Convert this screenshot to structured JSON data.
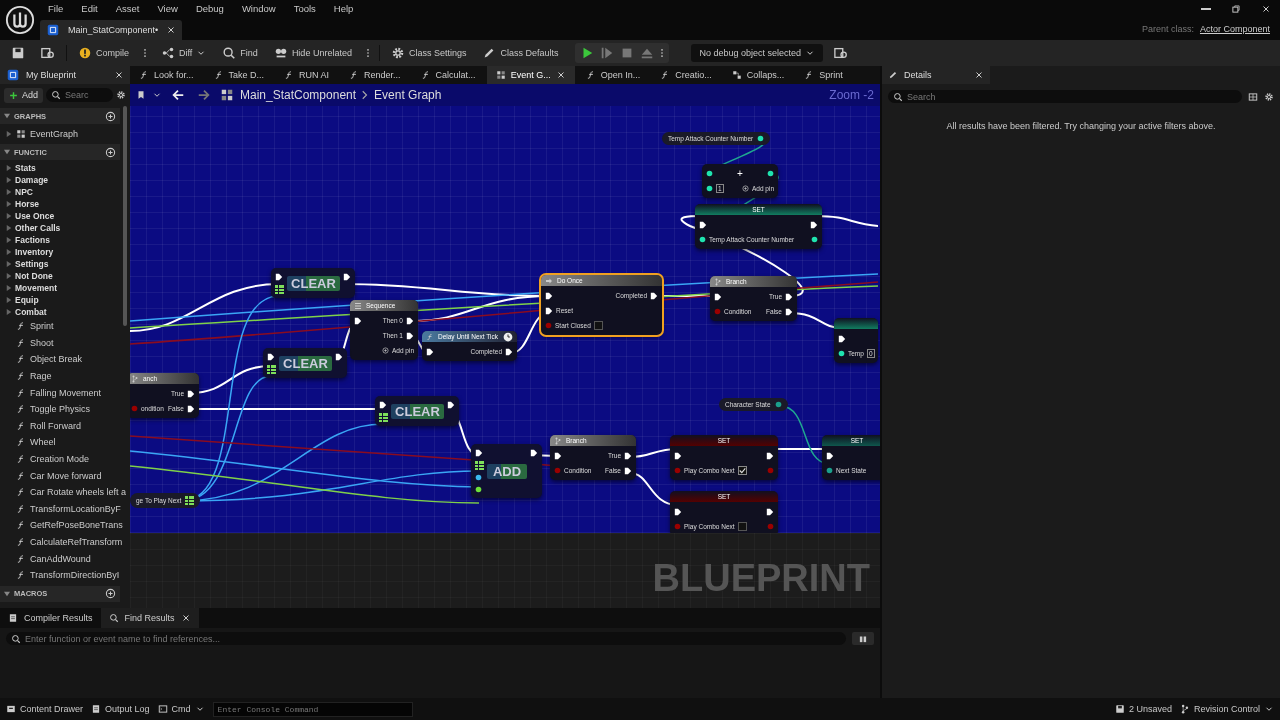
{
  "menu": [
    "File",
    "Edit",
    "Asset",
    "View",
    "Debug",
    "Window",
    "Tools",
    "Help"
  ],
  "document_tab": {
    "label": "Main_StatComponent•"
  },
  "parent_class": {
    "label": "Parent class:",
    "value": "Actor Component"
  },
  "toolbar": [
    {
      "kind": "icon"
    },
    {
      "kind": "icon"
    },
    {
      "kind": "button",
      "label": "Compile",
      "menu": true
    },
    {
      "kind": "button",
      "label": "Diff",
      "dropdown": true
    },
    {
      "kind": "button",
      "label": "Find"
    },
    {
      "kind": "button",
      "label": "Hide Unrelated",
      "menu": true
    },
    {
      "kind": "button",
      "label": "Class Settings"
    },
    {
      "kind": "button",
      "label": "Class Defaults"
    }
  ],
  "debug": {
    "selector": "No debug object selected"
  },
  "my_blueprint": {
    "title": "My Blueprint",
    "add": "Add",
    "search_placeholder": "Searc",
    "sections": [
      {
        "title": "GRAPHS",
        "expanded": true,
        "items": [
          {
            "kind": "graph",
            "label": "EventGraph"
          }
        ]
      },
      {
        "title": "FUNCTIC",
        "expanded": true,
        "items": [
          {
            "kind": "category",
            "label": "Stats",
            "expanded": false
          },
          {
            "kind": "category",
            "label": "Damage",
            "expanded": false
          },
          {
            "kind": "category",
            "label": "NPC",
            "expanded": false
          },
          {
            "kind": "category",
            "label": "Horse",
            "expanded": false
          },
          {
            "kind": "category",
            "label": "Use Once",
            "expanded": false
          },
          {
            "kind": "category",
            "label": "Other Calls",
            "expanded": false
          },
          {
            "kind": "category",
            "label": "Factions",
            "expanded": false
          },
          {
            "kind": "category",
            "label": "Inventory",
            "expanded": false
          },
          {
            "kind": "category",
            "label": "Settings",
            "expanded": false
          },
          {
            "kind": "category",
            "label": "Not Done",
            "expanded": false
          },
          {
            "kind": "category",
            "label": "Movement",
            "expanded": false
          },
          {
            "kind": "category",
            "label": "Equip",
            "expanded": false
          },
          {
            "kind": "category",
            "label": "Combat",
            "expanded": false
          },
          {
            "kind": "function",
            "label": "Sprint"
          },
          {
            "kind": "function",
            "label": "Shoot"
          },
          {
            "kind": "function",
            "label": "Object Break"
          },
          {
            "kind": "function",
            "label": "Rage"
          },
          {
            "kind": "function",
            "label": "Falling Movement"
          },
          {
            "kind": "function",
            "label": "Toggle Physics"
          },
          {
            "kind": "function",
            "label": "Roll Forward"
          },
          {
            "kind": "function",
            "label": "Wheel"
          },
          {
            "kind": "function",
            "label": "Creation Mode"
          },
          {
            "kind": "function",
            "label": "Car Move forward"
          },
          {
            "kind": "function",
            "label": "Car Rotate wheels left a"
          },
          {
            "kind": "function",
            "label": "TransformLocationByF"
          },
          {
            "kind": "function",
            "label": "GetRefPoseBoneTrans"
          },
          {
            "kind": "function",
            "label": "CalculateRefTransform"
          },
          {
            "kind": "function",
            "label": "CanAddWound"
          },
          {
            "kind": "function",
            "label": "TransformDirectionByI"
          }
        ]
      },
      {
        "title": "MACROS",
        "expanded": true
      }
    ]
  },
  "graph_tabs": [
    {
      "kind": "function",
      "label": "Look for...",
      "selected": false
    },
    {
      "kind": "function",
      "label": "Take D...",
      "selected": false
    },
    {
      "kind": "function",
      "label": "RUN AI",
      "selected": false
    },
    {
      "kind": "function",
      "label": "Render...",
      "selected": false
    },
    {
      "kind": "function",
      "label": "Calculat...",
      "selected": false
    },
    {
      "kind": "graph",
      "label": "Event G...",
      "selected": true
    },
    {
      "kind": "function",
      "label": "Open In...",
      "selected": false
    },
    {
      "kind": "function",
      "label": "Creatio...",
      "selected": false
    },
    {
      "kind": "collapsed",
      "label": "Collaps...",
      "selected": false
    },
    {
      "kind": "function",
      "label": "Sprint",
      "selected": false
    }
  ],
  "breadcrumb": [
    "Main_StatComponent",
    "Event Graph"
  ],
  "zoom": "Zoom -2",
  "graph_watermark": "BLUEPRINT",
  "nodes": [
    {
      "kind": "getter",
      "label": "Temp Attack Counter Number",
      "color": "#1fe3af",
      "selected": false
    },
    {
      "kind": "math",
      "symbol": "+",
      "selected": false,
      "rows": [
        {
          "left": {
            "kind": "data",
            "color": "#1fe3af"
          },
          "right": {
            "kind": "data",
            "color": "#1fe3af"
          }
        },
        {
          "left": {
            "kind": "data",
            "color": "#1fe3af",
            "value": "1"
          },
          "right": {
            "kind": "addpin",
            "label": "Add pin"
          }
        }
      ]
    },
    {
      "kind": "set",
      "title": "SET",
      "selected": false,
      "rows": [
        {
          "left": {
            "kind": "exec"
          },
          "right": {
            "kind": "exec"
          }
        },
        {
          "left": {
            "kind": "data",
            "color": "#1fe3af",
            "label": "Temp Attack Counter Number"
          },
          "right": {
            "kind": "data",
            "color": "#1fe3af"
          }
        }
      ]
    },
    {
      "kind": "array",
      "title": "CLEAR",
      "selected": false,
      "rows": [
        {
          "left": {
            "kind": "exec"
          },
          "right": {
            "kind": "exec"
          }
        },
        {
          "left": {
            "kind": "array",
            "color": "#7ee05a"
          }
        }
      ]
    },
    {
      "kind": "flow",
      "title": "Sequence",
      "selected": false,
      "rows": [
        {
          "left": {
            "kind": "exec"
          },
          "right": {
            "kind": "exec",
            "label": "Then 0"
          }
        },
        {
          "right": {
            "kind": "exec",
            "label": "Then 1"
          }
        },
        {
          "right": {
            "kind": "addpin",
            "label": "Add pin"
          }
        }
      ]
    },
    {
      "kind": "array",
      "title": "CLEAR",
      "selected": false,
      "rows": [
        {
          "left": {
            "kind": "exec"
          },
          "right": {
            "kind": "exec"
          }
        },
        {
          "left": {
            "kind": "array",
            "color": "#7ee05a"
          }
        }
      ]
    },
    {
      "kind": "function",
      "title": "Delay Until Next Tick",
      "selected": false,
      "rows": [
        {
          "left": {
            "kind": "exec"
          },
          "right": {
            "kind": "exec",
            "label": "Completed"
          }
        }
      ]
    },
    {
      "kind": "flow",
      "title": "Do Once",
      "selected": true,
      "rows": [
        {
          "left": {
            "kind": "exec"
          },
          "right": {
            "kind": "exec",
            "label": "Completed"
          }
        },
        {
          "left": {
            "kind": "exec",
            "label": "Reset"
          }
        },
        {
          "left": {
            "kind": "data",
            "color": "#9a0000",
            "label": "Start Closed",
            "checked": false
          }
        }
      ]
    },
    {
      "kind": "flow",
      "title": "Branch",
      "selected": false,
      "rows": [
        {
          "left": {
            "kind": "exec"
          },
          "right": {
            "kind": "exec",
            "label": "True"
          }
        },
        {
          "left": {
            "kind": "data",
            "color": "#9a0000",
            "label": "Condition"
          },
          "right": {
            "kind": "exec",
            "label": "False"
          }
        }
      ]
    },
    {
      "kind": "set",
      "selected": false,
      "rows": [
        {
          "left": {
            "kind": "exec"
          }
        },
        {
          "left": {
            "kind": "data",
            "color": "#1fe3af",
            "label": "Temp",
            "value": "0"
          }
        }
      ]
    },
    {
      "kind": "flow",
      "title": "anch",
      "selected": false,
      "rows": [
        {
          "right": {
            "kind": "exec",
            "label": "True"
          }
        },
        {
          "left": {
            "kind": "data",
            "color": "#9a0000",
            "label": "ondition"
          },
          "right": {
            "kind": "exec",
            "label": "False"
          }
        }
      ]
    },
    {
      "kind": "array",
      "title": "CLEAR",
      "selected": false,
      "rows": [
        {
          "left": {
            "kind": "exec"
          },
          "right": {
            "kind": "exec"
          }
        },
        {
          "left": {
            "kind": "array",
            "color": "#7ee05a"
          }
        }
      ]
    },
    {
      "kind": "getter",
      "label": "Character State",
      "color": "#1b9f8c",
      "selected": false
    },
    {
      "kind": "array",
      "title": "ADD",
      "selected": false,
      "rows": [
        {
          "left": {
            "kind": "exec"
          },
          "right": {
            "kind": "exec"
          }
        },
        {
          "left": {
            "kind": "array",
            "color": "#7ee05a"
          }
        },
        {
          "left": {
            "kind": "data",
            "color": "#3ab8f0"
          }
        },
        {
          "left": {
            "kind": "data",
            "color": "#6ee03a"
          }
        }
      ]
    },
    {
      "kind": "flow",
      "title": "Branch",
      "selected": false,
      "rows": [
        {
          "left": {
            "kind": "exec"
          },
          "right": {
            "kind": "exec",
            "label": "True"
          }
        },
        {
          "left": {
            "kind": "data",
            "color": "#9a0000",
            "label": "Condition"
          },
          "right": {
            "kind": "exec",
            "label": "False"
          }
        }
      ]
    },
    {
      "kind": "set",
      "title": "SET",
      "selected": false,
      "rows": [
        {
          "left": {
            "kind": "exec"
          },
          "right": {
            "kind": "exec"
          }
        },
        {
          "left": {
            "kind": "data",
            "color": "#9a0000",
            "label": "Play Combo Next",
            "checked": true
          },
          "right": {
            "kind": "data",
            "color": "#9a0000"
          }
        }
      ]
    },
    {
      "kind": "set",
      "title": "SET",
      "selected": false,
      "rows": [
        {
          "left": {
            "kind": "exec"
          }
        },
        {
          "left": {
            "kind": "data",
            "color": "#1b9f8c",
            "label": "Next State"
          }
        }
      ]
    },
    {
      "kind": "set",
      "title": "SET",
      "selected": false,
      "rows": [
        {
          "left": {
            "kind": "exec"
          },
          "right": {
            "kind": "exec"
          }
        },
        {
          "left": {
            "kind": "data",
            "color": "#9a0000",
            "label": "Play Combo Next",
            "checked": false
          },
          "right": {
            "kind": "data",
            "color": "#9a0000"
          }
        }
      ]
    },
    {
      "kind": "getter",
      "label": "ge To Play Next",
      "color": "#7ee05a",
      "selected": false
    }
  ],
  "details": {
    "title": "Details",
    "search_placeholder": "Search",
    "message": "All results have been filtered. Try changing your active filters above."
  },
  "bottom_tabs": [
    {
      "label": "Compiler Results",
      "selected": false
    },
    {
      "label": "Find Results",
      "selected": true
    }
  ],
  "find_placeholder": "Enter function or event name to find references...",
  "status_bar": {
    "content_drawer": "Content Drawer",
    "output_log": "Output Log",
    "cmd": "Cmd",
    "console_placeholder": "Enter Console Command",
    "unsaved": "2 Unsaved",
    "revision": "Revision Control"
  }
}
